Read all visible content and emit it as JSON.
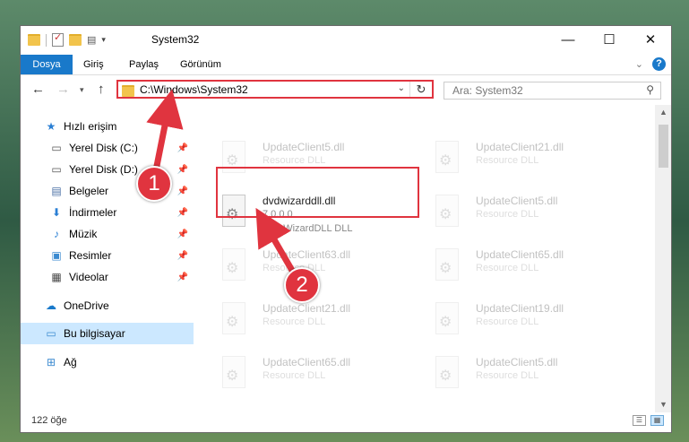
{
  "window": {
    "title": "System32",
    "controls": {
      "minimize": "—",
      "maximize": "☐",
      "close": "✕"
    }
  },
  "ribbon": {
    "tabs": [
      "Dosya",
      "Giriş",
      "Paylaş",
      "Görünüm"
    ],
    "help": "?"
  },
  "address": {
    "path": "C:\\Windows\\System32",
    "search_placeholder": "Ara: System32"
  },
  "nav": {
    "items": [
      {
        "label": "Hızlı erişim",
        "icon": "star-icon"
      },
      {
        "label": "Yerel Disk (C:)",
        "icon": "drive-icon",
        "pinned": true
      },
      {
        "label": "Yerel Disk (D:)",
        "icon": "drive-icon",
        "pinned": true
      },
      {
        "label": "Belgeler",
        "icon": "documents-icon",
        "pinned": true
      },
      {
        "label": "İndirmeler",
        "icon": "download-icon",
        "pinned": true
      },
      {
        "label": "Müzik",
        "icon": "music-icon",
        "pinned": true
      },
      {
        "label": "Resimler",
        "icon": "pictures-icon",
        "pinned": true
      },
      {
        "label": "Videolar",
        "icon": "videos-icon",
        "pinned": true
      },
      {
        "label": "OneDrive",
        "icon": "cloud-icon"
      },
      {
        "label": "Bu bilgisayar",
        "icon": "computer-icon",
        "selected": true
      },
      {
        "label": "Ağ",
        "icon": "network-icon"
      }
    ]
  },
  "files": [
    {
      "name": "UpdateClient5.dll",
      "sub": "Resource DLL"
    },
    {
      "name": "UpdateClient21.dll",
      "sub": "Resource DLL"
    },
    {
      "name": "dvdwizarddll.dll",
      "version": "7.0.0.0",
      "sub": "DVDWizardDLL DLL",
      "highlighted": true
    },
    {
      "name": "UpdateClient5.dll",
      "sub": "Resource DLL"
    },
    {
      "name": "UpdateClient63.dll",
      "sub": "Resource DLL"
    },
    {
      "name": "UpdateClient65.dll",
      "sub": "Resource DLL"
    },
    {
      "name": "UpdateClient21.dll",
      "sub": "Resource DLL"
    },
    {
      "name": "UpdateClient19.dll",
      "sub": "Resource DLL"
    },
    {
      "name": "UpdateClient65.dll",
      "sub": "Resource DLL"
    },
    {
      "name": "UpdateClient5.dll",
      "sub": "Resource DLL"
    }
  ],
  "status": {
    "count": "122 öğe"
  },
  "annotations": {
    "badge1": "1",
    "badge2": "2",
    "color": "#e0343f"
  }
}
